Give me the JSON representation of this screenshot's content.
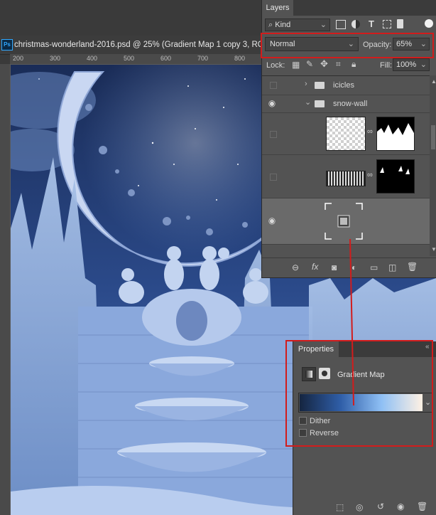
{
  "document": {
    "title": "christmas-wonderland-2016.psd @ 25% (Gradient Map 1 copy 3, RG"
  },
  "ruler": {
    "ticks": [
      "200",
      "300",
      "400",
      "500",
      "600",
      "700",
      "800"
    ]
  },
  "layers_panel": {
    "tab": "Layers",
    "filter_kind": "Kind",
    "blend_mode": "Normal",
    "opacity_label": "Opacity:",
    "opacity_value": "65%",
    "lock_label": "Lock:",
    "fill_label": "Fill:",
    "fill_value": "100%",
    "groups": [
      {
        "name": "icicles",
        "expanded": false
      },
      {
        "name": "snow-wall",
        "expanded": true
      }
    ]
  },
  "properties_panel": {
    "tab": "Properties",
    "adjustment_name": "Gradient Map",
    "gradient_colors": [
      "#152540",
      "#2f5ea8",
      "#8fc0f5",
      "#fff1e3"
    ],
    "dither_label": "Dither",
    "reverse_label": "Reverse"
  },
  "colors": {
    "annotation": "#d21c1c",
    "panel_bg": "#535353",
    "selected_row": "#6a6a6a"
  }
}
